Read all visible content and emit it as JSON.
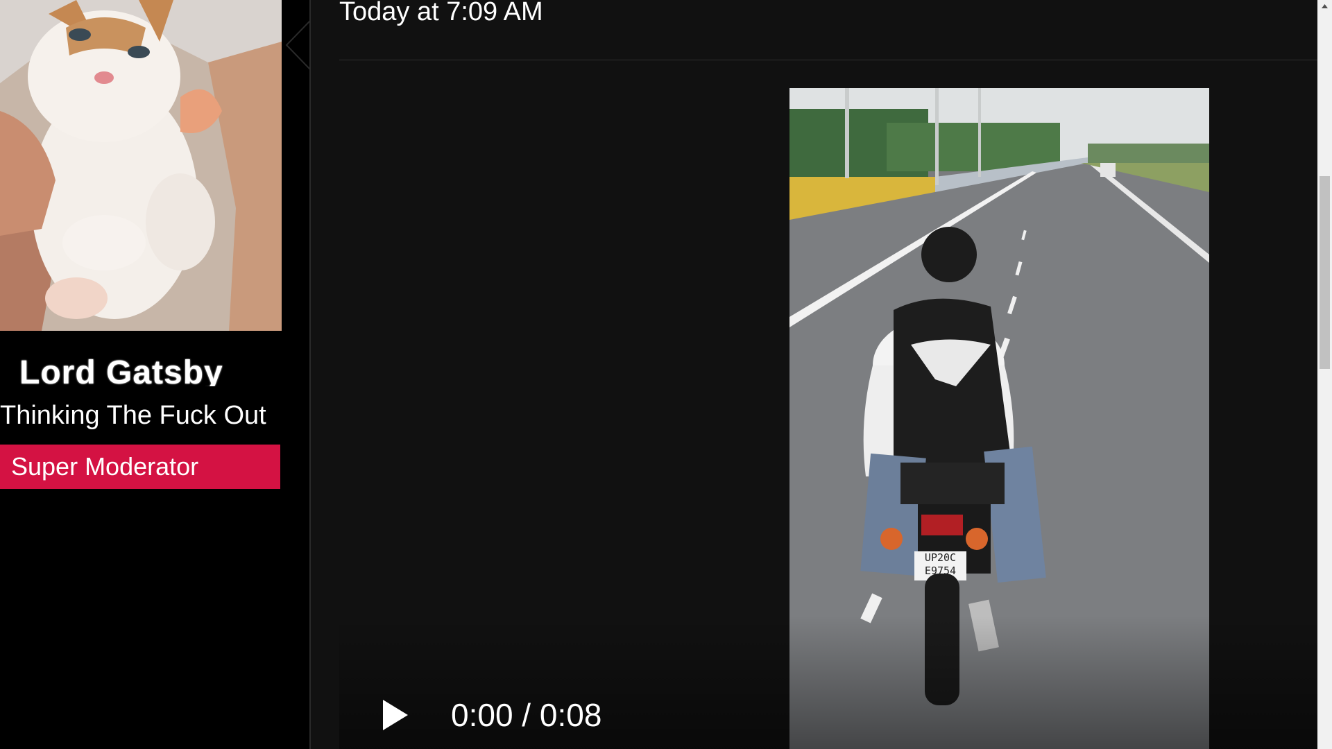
{
  "sidebar": {
    "avatar_icon": "kitten-avatar",
    "user_name": "Lord Gatsby",
    "user_title": "Thinking The Fuck Out",
    "role_badge": "Super Moderator",
    "badge_color": "#d41243"
  },
  "post": {
    "date": "Today at 7:09 AM"
  },
  "video": {
    "play_icon": "play-icon",
    "time": "0:00 / 0:08",
    "plate_line1": "UP20C",
    "plate_line2": "E9754"
  },
  "colors": {
    "background": "#111111",
    "sidebar": "#000000",
    "accent": "#d41243"
  }
}
